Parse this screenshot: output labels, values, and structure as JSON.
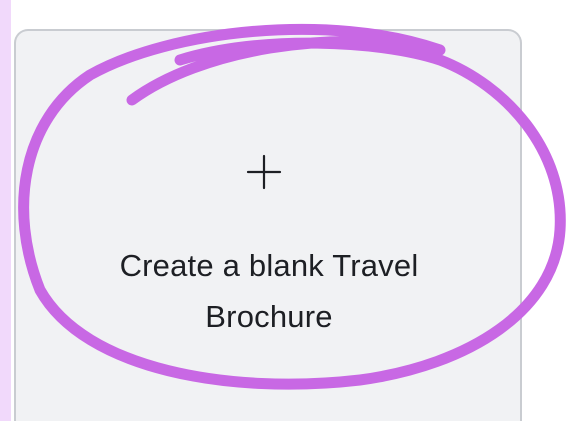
{
  "card": {
    "label": "Create a blank Travel Brochure",
    "icon": "plus-icon"
  },
  "colors": {
    "highlight": "#c868e4",
    "card_background": "#f1f2f4",
    "card_border": "#c9ccd1",
    "left_strip": "#f1d9fb",
    "text": "#1d1f24"
  }
}
